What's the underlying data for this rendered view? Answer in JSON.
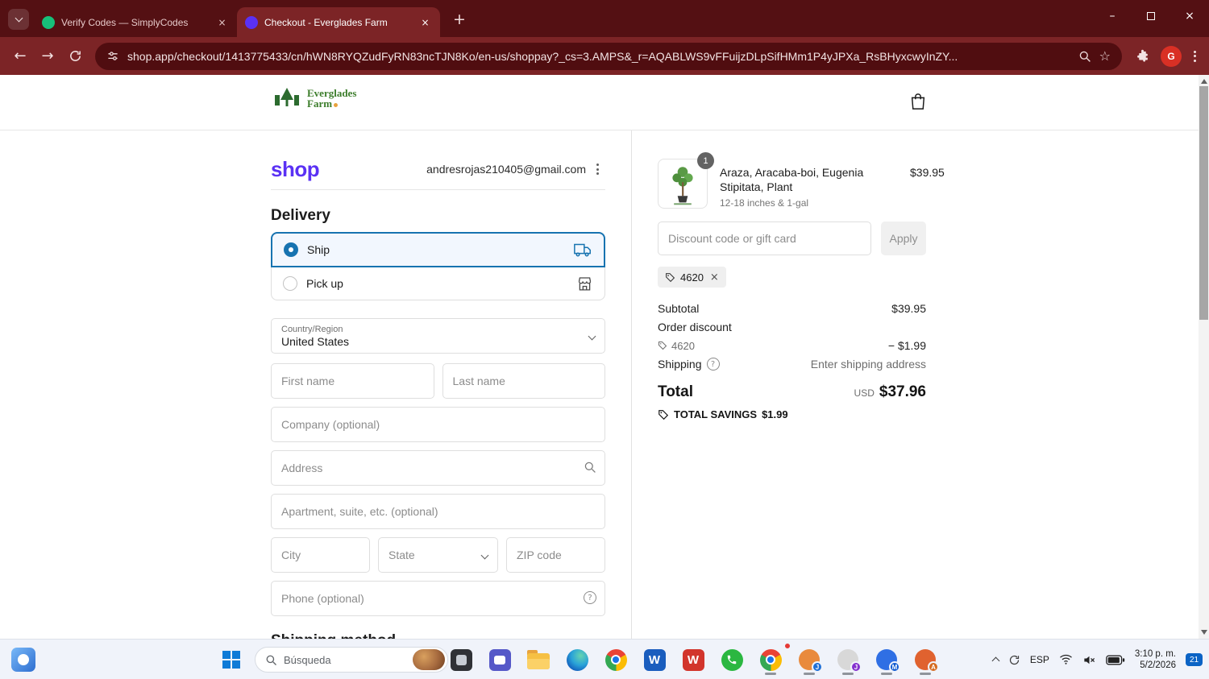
{
  "colors": {
    "accent_blue": "#1773b0",
    "shop_purple": "#5a31f4",
    "chrome_theme_dark": "#541013",
    "chrome_theme": "#7c2426",
    "logo_green": "#3c7d2b"
  },
  "glyphs": {
    "back": "←",
    "forward": "→",
    "plus": "+",
    "close": "×",
    "minimize": "–",
    "star": "☆",
    "question": "?"
  },
  "browser": {
    "tabs": [
      {
        "title": "Verify Codes — SimplyCodes"
      },
      {
        "title": "Checkout - Everglades Farm"
      }
    ],
    "url": "shop.app/checkout/1413775433/cn/hWN8RYQZudFyRN83ncTJN8Ko/en-us/shoppay?_cs=3.AMPS&_r=AQABLWS9vFFuijzDLpSifHMm1P4yJPXa_RsBHyxcwyInZY...",
    "profile_initial": "G"
  },
  "header": {
    "logo_line1": "Everglades",
    "logo_line2": "Farm"
  },
  "checkout": {
    "brand": "shop",
    "email": "andresrojas210405@gmail.com",
    "delivery_title": "Delivery",
    "ship_label": "Ship",
    "pickup_label": "Pick up",
    "form": {
      "country_label": "Country/Region",
      "country_value": "United States",
      "first_name": "First name",
      "last_name": "Last name",
      "company": "Company (optional)",
      "address": "Address",
      "apartment": "Apartment, suite, etc. (optional)",
      "city": "City",
      "state": "State",
      "zip": "ZIP code",
      "phone": "Phone (optional)"
    },
    "shipping_method_title": "Shipping method"
  },
  "summary": {
    "item": {
      "qty": "1",
      "title": "Araza, Aracaba-boi, Eugenia Stipitata, Plant",
      "variant": "12-18 inches & 1-gal",
      "price": "$39.95"
    },
    "discount_placeholder": "Discount code or gift card",
    "apply_label": "Apply",
    "chip_code": "4620",
    "subtotal_label": "Subtotal",
    "subtotal_value": "$39.95",
    "discount_label": "Order discount",
    "discount_code": "4620",
    "discount_value": "− $1.99",
    "shipping_label": "Shipping",
    "shipping_value": "Enter shipping address",
    "total_label": "Total",
    "currency": "USD",
    "total_value": "$37.96",
    "savings_label": "TOTAL SAVINGS",
    "savings_value": "$1.99"
  },
  "taskbar": {
    "search_placeholder": "Búsqueda",
    "word_letter": "W",
    "wred_letter": "W",
    "profile_letters": [
      "J",
      "J",
      "M",
      "A"
    ],
    "tray": {
      "lang": "ESP",
      "time": "3:10 p. m.",
      "date": "5/2/2026",
      "badge": "21"
    }
  }
}
